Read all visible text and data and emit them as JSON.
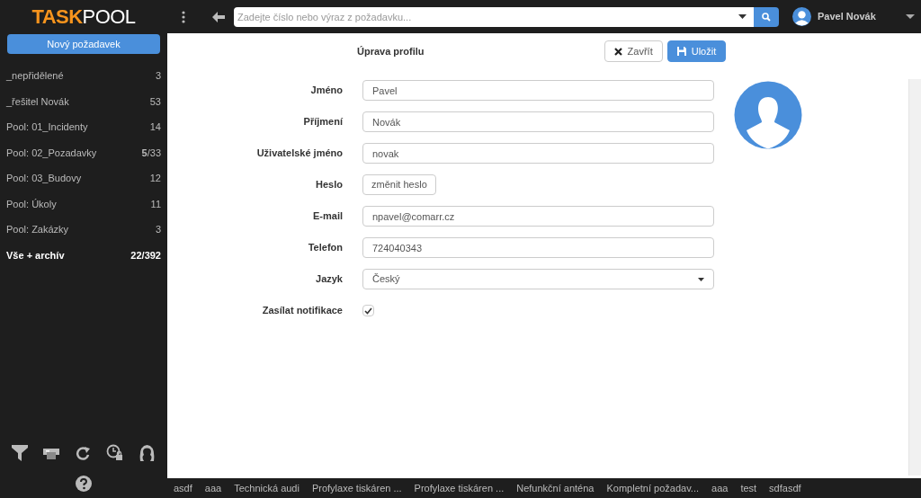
{
  "header": {
    "logo_bold": "TASK",
    "logo_light": "POOL",
    "search": {
      "placeholder": "Zadejte číslo nebo výraz z požadavku..."
    },
    "user": "Pavel Novák"
  },
  "sidebar": {
    "new_button": "Nový požadavek",
    "items": [
      {
        "label": "_nepřidělené",
        "count": "3",
        "emphasized": false
      },
      {
        "label": "_řešitel Novák",
        "count": "53",
        "emphasized": false
      },
      {
        "label": "Pool: 01_Incidenty",
        "count": "14",
        "emphasized": false
      },
      {
        "label": "Pool: 02_Pozadavky",
        "count": "**5**/33",
        "emphasized": false
      },
      {
        "label": "Pool: 03_Budovy",
        "count": "12",
        "emphasized": false
      },
      {
        "label": "Pool: Úkoly",
        "count": "11",
        "emphasized": false
      },
      {
        "label": "Pool: Zakázky",
        "count": "3",
        "emphasized": false
      },
      {
        "label": "Vše + archív",
        "count": "22/392",
        "emphasized": true
      }
    ]
  },
  "form": {
    "title": "Úprava profilu",
    "buttons": [
      {
        "kind": "close",
        "label": "Zavřít"
      },
      {
        "kind": "save",
        "label": "Uložit"
      }
    ],
    "fields": [
      {
        "kind": "text",
        "label": "Jméno",
        "value": "Pavel"
      },
      {
        "kind": "text",
        "label": "Příjmení",
        "value": "Novák"
      },
      {
        "kind": "text",
        "label": "Uživatelské jméno",
        "value": "novak"
      },
      {
        "kind": "button",
        "label": "Heslo",
        "value": "změnit heslo"
      },
      {
        "kind": "text",
        "label": "E-mail",
        "value": "npavel@comarr.cz"
      },
      {
        "kind": "text",
        "label": "Telefon",
        "value": "724040343"
      },
      {
        "kind": "select",
        "label": "Jazyk",
        "value": "Český"
      },
      {
        "kind": "checkbox",
        "label": "Zasílat notifikace",
        "checked": true
      }
    ]
  },
  "taskbar": [
    "asdf",
    "aaa",
    "Technická audi",
    "Profylaxe tiskáren ...",
    "Profylaxe tiskáren ...",
    "Nefunkční anténa",
    "Kompletní požadav...",
    "aaa",
    "test",
    "sdfasdf"
  ]
}
